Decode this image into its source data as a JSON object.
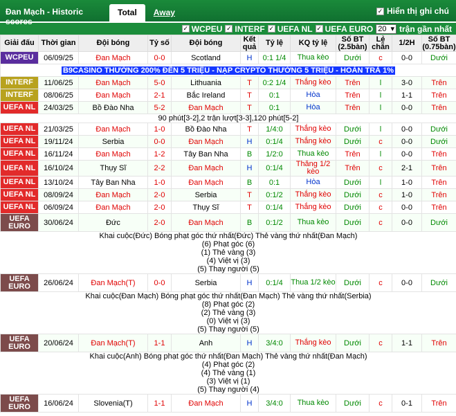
{
  "header": {
    "title": "Đan Mạch - Historic scores",
    "tab_total": "Total",
    "tab_away": "Away",
    "show_comments": "Hiển thị ghi chú"
  },
  "filters": {
    "items": [
      "WCPEU",
      "INTERF",
      "UEFA NL",
      "UEFA EURO"
    ],
    "count_value": "20",
    "count_suffix": "trận gần nhất"
  },
  "columns": [
    "Giải đấu",
    "Thời gian",
    "Đội bóng",
    "Tỷ số",
    "Đội bóng",
    "Kết quả",
    "Tỷ lệ",
    "KQ tỷ lệ",
    "Số BT (2.5bàn)",
    "Lẻ chẵn",
    "1/2H",
    "Số BT (0.75bàn)"
  ],
  "colors": {
    "WCPEU": "#5a2d9e",
    "INTERF": "#b8a21e",
    "UEFA NL": "#e22a2a",
    "UEFA EURO": "#7c4b4b"
  },
  "promo": "B9CASINO THƯỞNG 200% ĐẾN 5 TRIỆU - NẠP CRYPTO THƯỞNG 5 TRIỆU - HOÀN TRẢ 1%",
  "rows": [
    {
      "lg": "WCPEU",
      "date": "06/09/25",
      "home": "Đan Mạch",
      "score": "0-0",
      "away": "Scotland",
      "res": "H",
      "hc": "0:1 1/4",
      "hcr": "Thua kèo",
      "ou": "Dưới",
      "oe": "c",
      "ht": "0-0",
      "ou2": "Dưới"
    },
    {
      "lg": "INTERF",
      "date": "11/06/25",
      "home": "Đan Mạch",
      "score": "5-0",
      "away": "Lithuania",
      "res": "T",
      "hc": "0:2 1/4",
      "hcr": "Thắng kèo",
      "ou": "Trên",
      "oe": "l",
      "ht": "3-0",
      "ou2": "Trên"
    },
    {
      "lg": "INTERF",
      "date": "08/06/25",
      "home": "Đan Mạch",
      "score": "2-1",
      "away": "Bắc Ireland",
      "res": "T",
      "hc": "0:1",
      "hcr": "Hòa",
      "ou": "Trên",
      "oe": "l",
      "ht": "1-1",
      "ou2": "Trên"
    },
    {
      "lg": "UEFA NL",
      "date": "24/03/25",
      "home": "Bồ Đào Nha",
      "score": "5-2",
      "away": "Đan Mạch",
      "res": "T",
      "hc": "0:1",
      "hcr": "Hòa",
      "ou": "Trên",
      "oe": "l",
      "ht": "0-0",
      "ou2": "Trên"
    },
    {
      "lg": "UEFA NL",
      "date": "21/03/25",
      "home": "Đan Mạch",
      "score": "1-0",
      "away": "Bồ Đào Nha",
      "res": "T",
      "hc": "1/4:0",
      "hcr": "Thắng kèo",
      "ou": "Dưới",
      "oe": "l",
      "ht": "0-0",
      "ou2": "Dưới"
    },
    {
      "lg": "UEFA NL",
      "date": "19/11/24",
      "home": "Serbia",
      "score": "0-0",
      "away": "Đan Mạch",
      "res": "H",
      "hc": "0:1/4",
      "hcr": "Thắng kèo",
      "ou": "Dưới",
      "oe": "c",
      "ht": "0-0",
      "ou2": "Dưới"
    },
    {
      "lg": "UEFA NL",
      "date": "16/11/24",
      "home": "Đan Mạch",
      "score": "1-2",
      "away": "Tây Ban Nha",
      "res": "B",
      "hc": "1/2:0",
      "hcr": "Thua kèo",
      "ou": "Trên",
      "oe": "l",
      "ht": "0-0",
      "ou2": "Trên"
    },
    {
      "lg": "UEFA NL",
      "date": "16/10/24",
      "home": "Thụy Sĩ",
      "score": "2-2",
      "away": "Đan Mạch",
      "res": "H",
      "hc": "0:1/4",
      "hcr": "Thắng 1/2 kèo",
      "ou": "Trên",
      "oe": "c",
      "ht": "2-1",
      "ou2": "Trên"
    },
    {
      "lg": "UEFA NL",
      "date": "13/10/24",
      "home": "Tây Ban Nha",
      "score": "1-0",
      "away": "Đan Mạch",
      "res": "B",
      "hc": "0:1",
      "hcr": "Hòa",
      "ou": "Dưới",
      "oe": "l",
      "ht": "1-0",
      "ou2": "Trên"
    },
    {
      "lg": "UEFA NL",
      "date": "08/09/24",
      "home": "Đan Mạch",
      "score": "2-0",
      "away": "Serbia",
      "res": "T",
      "hc": "0:1/2",
      "hcr": "Thắng kèo",
      "ou": "Dưới",
      "oe": "c",
      "ht": "1-0",
      "ou2": "Trên"
    },
    {
      "lg": "UEFA NL",
      "date": "06/09/24",
      "home": "Đan Mạch",
      "score": "2-0",
      "away": "Thụy Sĩ",
      "res": "T",
      "hc": "0:1/4",
      "hcr": "Thắng kèo",
      "ou": "Dưới",
      "oe": "c",
      "ht": "0-0",
      "ou2": "Trên"
    },
    {
      "lg": "UEFA EURO",
      "date": "30/06/24",
      "home": "Đức",
      "score": "2-0",
      "away": "Đan Mạch",
      "res": "B",
      "hc": "0:1/2",
      "hcr": "Thua kèo",
      "ou": "Dưới",
      "oe": "c",
      "ht": "0-0",
      "ou2": "Dưới"
    },
    {
      "lg": "UEFA EURO",
      "date": "26/06/24",
      "home": "Đan Mạch(T)",
      "score": "0-0",
      "away": "Serbia",
      "res": "H",
      "hc": "0:1/4",
      "hcr": "Thua 1/2 kèo",
      "ou": "Dưới",
      "oe": "c",
      "ht": "0-0",
      "ou2": "Dưới"
    },
    {
      "lg": "UEFA EURO",
      "date": "20/06/24",
      "home": "Đan Mạch(T)",
      "score": "1-1",
      "away": "Anh",
      "res": "H",
      "hc": "3/4:0",
      "hcr": "Thắng kèo",
      "ou": "Dưới",
      "oe": "c",
      "ht": "1-1",
      "ou2": "Trên"
    },
    {
      "lg": "UEFA EURO",
      "date": "16/06/24",
      "home": "Slovenia(T)",
      "score": "1-1",
      "away": "Đan Mạch",
      "res": "H",
      "hc": "3/4:0",
      "hcr": "Thua kèo",
      "ou": "Dưới",
      "oe": "c",
      "ht": "0-1",
      "ou2": "Trên"
    }
  ],
  "notes": {
    "n1": "90 phút[3-2],2 trận lượt[3-3],120 phút[5-2]",
    "euro1": [
      "Khai cuộc(Đức)   Bóng phạt góc thứ nhất(Đức)   Thẻ vàng thứ nhất(Đan Mạch)",
      "(6) Phạt góc (6)",
      "(1) Thẻ vàng (3)",
      "(4) Việt vị (3)",
      "(5) Thay người (5)"
    ],
    "euro2": [
      "Khai cuộc(Đan Mạch)   Bóng phạt góc thứ nhất(Đan Mạch)   Thẻ vàng thứ nhất(Serbia)",
      "(8) Phạt góc (2)",
      "(2) Thẻ vàng (3)",
      "(0) Việt vị (3)",
      "(5) Thay người (5)"
    ],
    "euro3": [
      "Khai cuộc(Anh)   Bóng phạt góc thứ nhất(Đan Mạch)   Thẻ vàng thứ nhất(Đan Mạch)",
      "(4) Phạt góc (2)",
      "(4) Thẻ vàng (1)",
      "(3) Việt vị (1)",
      "(5) Thay người (4)"
    ]
  }
}
